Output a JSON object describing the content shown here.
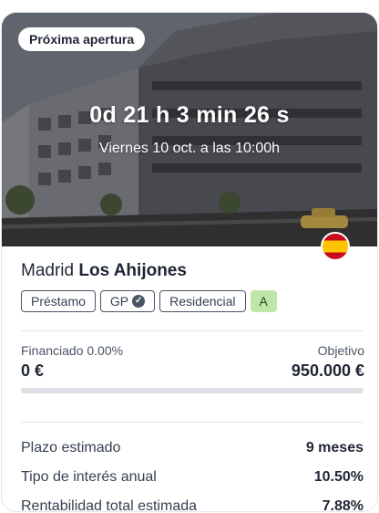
{
  "hero": {
    "badge": "Próxima apertura",
    "countdown": "0d 21 h 3 min 26 s",
    "opening_date": "Viernes 10 oct. a las 10:00h"
  },
  "country_flag": "spain-flag-icon",
  "project": {
    "city": "Madrid",
    "name": "Los Ahijones"
  },
  "tags": [
    {
      "label": "Préstamo"
    },
    {
      "label": "GP",
      "icon": "verified-check-icon"
    },
    {
      "label": "Residencial"
    },
    {
      "label": "A"
    }
  ],
  "funding": {
    "financed_label": "Financiado 0.00%",
    "financed_value": "0 €",
    "target_label": "Objetivo",
    "target_value": "950.000 €",
    "progress_fraction": 0.0
  },
  "details": [
    {
      "label": "Plazo estimado",
      "value": "9 meses"
    },
    {
      "label": "Tipo de interés anual",
      "value": "10.50%"
    },
    {
      "label": "Rentabilidad total estimada",
      "value": "7.88%"
    }
  ],
  "colors": {
    "rating_badge": "#bfe6a8",
    "progress_track": "#dcdfe4",
    "text_primary": "#1f2633"
  }
}
